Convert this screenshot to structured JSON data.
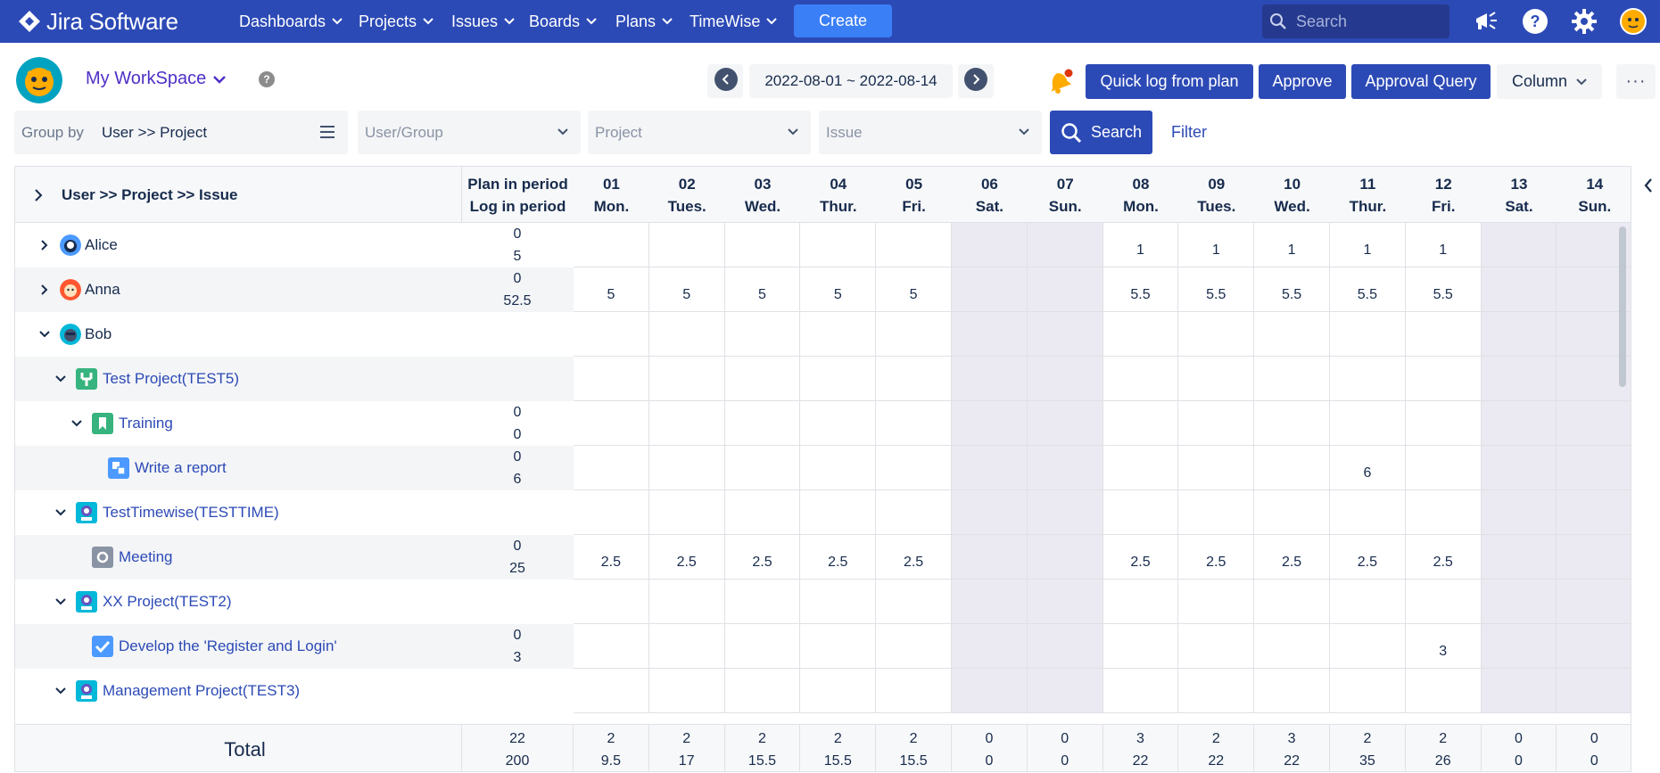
{
  "topnav": {
    "brand": "Jira Software",
    "items": [
      {
        "label": "Dashboards"
      },
      {
        "label": "Projects"
      },
      {
        "label": "Issues"
      },
      {
        "label": "Boards"
      },
      {
        "label": "Plans"
      },
      {
        "label": "TimeWise"
      }
    ],
    "create_label": "Create",
    "search_placeholder": "Search",
    "colors": {
      "bar": "#2c4ab6",
      "create": "#3b7ff7"
    }
  },
  "toolbar": {
    "workspace_label": "My WorkSpace",
    "help_glyph": "?",
    "date_range": "2022-08-01 ~ 2022-08-14",
    "buttons": {
      "quick_log": "Quick log from plan",
      "approve": "Approve",
      "approval_query": "Approval Query",
      "column": "Column",
      "more": "···"
    }
  },
  "filters": {
    "group_by_label": "Group by",
    "group_by_value": "User >> Project",
    "user_group_placeholder": "User/Group",
    "project_placeholder": "Project",
    "issue_placeholder": "Issue",
    "search_label": "Search",
    "filter_label": "Filter"
  },
  "grid": {
    "tree_header": "User >> Project >> Issue",
    "plan_header_1": "Plan in period",
    "plan_header_2": "Log in period",
    "days": [
      {
        "num": "01",
        "dow": "Mon.",
        "weekend": false
      },
      {
        "num": "02",
        "dow": "Tues.",
        "weekend": false
      },
      {
        "num": "03",
        "dow": "Wed.",
        "weekend": false
      },
      {
        "num": "04",
        "dow": "Thur.",
        "weekend": false
      },
      {
        "num": "05",
        "dow": "Fri.",
        "weekend": false
      },
      {
        "num": "06",
        "dow": "Sat.",
        "weekend": true
      },
      {
        "num": "07",
        "dow": "Sun.",
        "weekend": true
      },
      {
        "num": "08",
        "dow": "Mon.",
        "weekend": false
      },
      {
        "num": "09",
        "dow": "Tues.",
        "weekend": false
      },
      {
        "num": "10",
        "dow": "Wed.",
        "weekend": false
      },
      {
        "num": "11",
        "dow": "Thur.",
        "weekend": false
      },
      {
        "num": "12",
        "dow": "Fri.",
        "weekend": false
      },
      {
        "num": "13",
        "dow": "Sat.",
        "weekend": true
      },
      {
        "num": "14",
        "dow": "Sun.",
        "weekend": true
      }
    ],
    "rows": [
      {
        "kind": "user",
        "label": "Alice",
        "expanded": false,
        "level": 0,
        "avatar": "alice",
        "plan": "0",
        "log": "5",
        "cells": [
          "",
          "",
          "",
          "",
          "",
          "",
          "",
          "1",
          "1",
          "1",
          "1",
          "1",
          "",
          ""
        ]
      },
      {
        "kind": "user",
        "label": "Anna",
        "expanded": false,
        "level": 0,
        "avatar": "anna",
        "plan": "0",
        "log": "52.5",
        "cells": [
          "5",
          "5",
          "5",
          "5",
          "5",
          "",
          "",
          "5.5",
          "5.5",
          "5.5",
          "5.5",
          "5.5",
          "",
          ""
        ]
      },
      {
        "kind": "user",
        "label": "Bob",
        "expanded": true,
        "level": 0,
        "avatar": "bob",
        "plan": "",
        "log": "",
        "cells": [
          "",
          "",
          "",
          "",
          "",
          "",
          "",
          "",
          "",
          "",
          "",
          "",
          "",
          ""
        ]
      },
      {
        "kind": "project",
        "label": "Test Project(TEST5)",
        "expanded": true,
        "level": 1,
        "icon": "wrench-project",
        "plan": "",
        "log": "",
        "cells": [
          "",
          "",
          "",
          "",
          "",
          "",
          "",
          "",
          "",
          "",
          "",
          "",
          "",
          ""
        ]
      },
      {
        "kind": "issue",
        "label": "Training",
        "expanded": true,
        "level": 2,
        "icon": "story",
        "plan": "0",
        "log": "0",
        "cells": [
          "",
          "",
          "",
          "",
          "",
          "",
          "",
          "",
          "",
          "",
          "",
          "",
          "",
          ""
        ]
      },
      {
        "kind": "issue",
        "label": "Write a report",
        "expanded": null,
        "level": 3,
        "icon": "subtask",
        "plan": "0",
        "log": "6",
        "cells": [
          "",
          "",
          "",
          "",
          "",
          "",
          "",
          "",
          "",
          "",
          "6",
          "",
          "",
          ""
        ]
      },
      {
        "kind": "project",
        "label": "TestTimewise(TESTTIME)",
        "expanded": true,
        "level": 1,
        "icon": "robot-project",
        "plan": "",
        "log": "",
        "cells": [
          "",
          "",
          "",
          "",
          "",
          "",
          "",
          "",
          "",
          "",
          "",
          "",
          "",
          ""
        ]
      },
      {
        "kind": "issue",
        "label": "Meeting",
        "expanded": null,
        "level": 2,
        "icon": "circle-issue",
        "plan": "0",
        "log": "25",
        "cells": [
          "2.5",
          "2.5",
          "2.5",
          "2.5",
          "2.5",
          "",
          "",
          "2.5",
          "2.5",
          "2.5",
          "2.5",
          "2.5",
          "",
          ""
        ]
      },
      {
        "kind": "project",
        "label": "XX Project(TEST2)",
        "expanded": true,
        "level": 1,
        "icon": "robot-project",
        "plan": "",
        "log": "",
        "cells": [
          "",
          "",
          "",
          "",
          "",
          "",
          "",
          "",
          "",
          "",
          "",
          "",
          "",
          ""
        ]
      },
      {
        "kind": "issue",
        "label": "Develop the 'Register and Login'",
        "expanded": null,
        "level": 2,
        "icon": "task-check",
        "plan": "0",
        "log": "3",
        "cells": [
          "",
          "",
          "",
          "",
          "",
          "",
          "",
          "",
          "",
          "",
          "",
          "3",
          "",
          ""
        ]
      },
      {
        "kind": "project",
        "label": "Management Project(TEST3)",
        "expanded": true,
        "level": 1,
        "icon": "robot-project",
        "plan": "",
        "log": "",
        "cells": [
          "",
          "",
          "",
          "",
          "",
          "",
          "",
          "",
          "",
          "",
          "",
          "",
          "",
          ""
        ]
      }
    ],
    "total": {
      "label": "Total",
      "plan": "22",
      "log": "200",
      "days_plan": [
        "2",
        "2",
        "2",
        "2",
        "2",
        "0",
        "0",
        "3",
        "2",
        "3",
        "2",
        "2",
        "0",
        "0"
      ],
      "days_log": [
        "9.5",
        "17",
        "15.5",
        "15.5",
        "15.5",
        "0",
        "0",
        "22",
        "22",
        "22",
        "35",
        "26",
        "0",
        "0"
      ]
    }
  }
}
